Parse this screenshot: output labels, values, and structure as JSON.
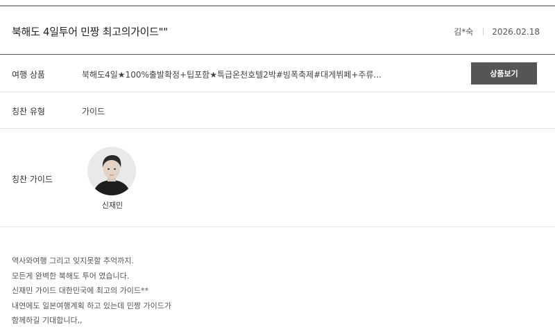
{
  "header": {
    "title": "북해도 4일투어 민짱 최고의가이드\"\"",
    "author": "김*숙",
    "date": "2026.02.18"
  },
  "product": {
    "label": "여행 상품",
    "value": "북해도4일★100%출발확정+팁포함★특급온천호텔2박#빙폭축제#대게뷔페+주류...",
    "button_label": "상품보기"
  },
  "praise_type": {
    "label": "칭찬 유형",
    "value": "가이드"
  },
  "guide": {
    "label": "칭찬 가이드",
    "name": "신재민",
    "avatar_icon": "guide-portrait-photo"
  },
  "body": {
    "lines": [
      "역사와여행 그리고 잊지못할 추억까지.",
      "모든게 완벽한 북해도 투어 였습니다.",
      "신재민 가이드 대한민국에 최고의 가이드**",
      "내연에도 일본여행계획 하고 있는데 민짱 가이드가",
      "함께하길 기대합니다,,"
    ]
  },
  "colors": {
    "button_bg": "#555555",
    "divider": "#e4e4e4",
    "header_rule": "#444444"
  }
}
